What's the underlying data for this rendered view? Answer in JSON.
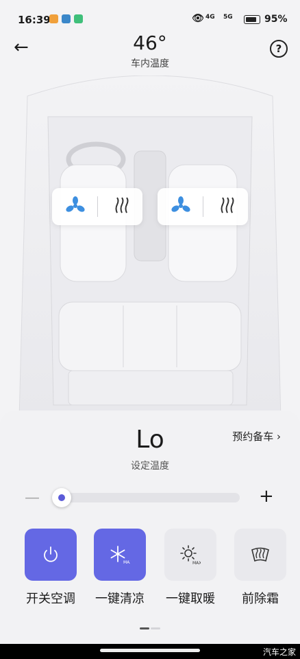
{
  "status_bar": {
    "time": "16:39",
    "network_1": "4G",
    "network_2": "5G",
    "battery": "95%"
  },
  "header": {
    "cabin_temp": "46°",
    "cabin_temp_label": "车内温度"
  },
  "panel": {
    "set_temp": "Lo",
    "set_temp_label": "设定温度",
    "schedule_link": "预约备车 ›",
    "slider_level": 0.0,
    "minus": "—",
    "plus": "+",
    "buttons": [
      {
        "label": "开关空调",
        "icon": "power-icon",
        "active": true
      },
      {
        "label": "一键清凉",
        "icon": "snowflake-max-icon",
        "active": true
      },
      {
        "label": "一键取暖",
        "icon": "sun-max-icon",
        "active": false
      },
      {
        "label": "前除霜",
        "icon": "front-defrost-icon",
        "active": false
      }
    ],
    "page_index": 1,
    "page_count": 2
  },
  "colors": {
    "accent": "#6468e4",
    "fan_blue": "#3d8fe0"
  },
  "watermark": "汽车之家"
}
